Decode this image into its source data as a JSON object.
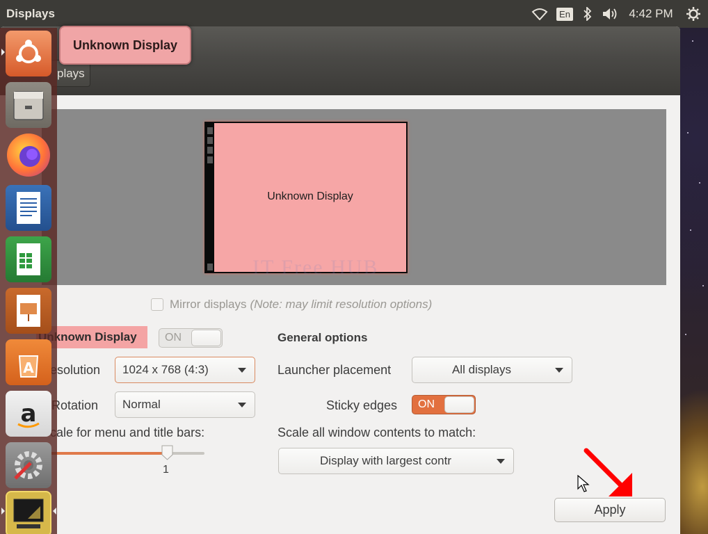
{
  "top_panel": {
    "title": "Displays",
    "keyboard_layout": "En",
    "clock": "4:42 PM",
    "icons": [
      "wifi-icon",
      "bluetooth-icon",
      "volume-icon",
      "settings-gear-icon"
    ]
  },
  "tooltip": {
    "text": "Unknown Display"
  },
  "header": {
    "breadcrumb_label": "plays"
  },
  "arrangement": {
    "monitor_label": "Unknown Display",
    "watermark": "IT Free HUB"
  },
  "mirror": {
    "label": "Mirror displays",
    "note": "(Note: may limit resolution options)",
    "checked": false
  },
  "display": {
    "name": "Unknown Display",
    "switch_label": "ON",
    "enabled": false,
    "resolution_label": "esolution",
    "resolution_value": "1024 x 768 (4:3)",
    "rotation_label": "Rotation",
    "rotation_value": "Normal",
    "scale_label": "cale for menu and title bars:",
    "scale_value": "1",
    "scale_fraction": 0.75
  },
  "general": {
    "title": "General options",
    "launcher_placement_label": "Launcher placement",
    "launcher_placement_value": "All displays",
    "sticky_edges_label": "Sticky edges",
    "sticky_edges_switch": "ON",
    "sticky_edges_enabled": true,
    "scale_all_label": "Scale all window contents to match:",
    "scale_all_value": "Display with largest contr"
  },
  "apply_label": "Apply",
  "launcher": {
    "items": [
      "ubuntu-logo-icon",
      "files-icon",
      "firefox-icon",
      "writer-icon",
      "calc-icon",
      "impress-icon",
      "software-center-icon",
      "amazon-icon",
      "system-settings-icon",
      "displays-icon"
    ]
  },
  "colors": {
    "accent": "#e2703f",
    "display_highlight": "#f6a6a6",
    "annotation": "#ff0000"
  }
}
